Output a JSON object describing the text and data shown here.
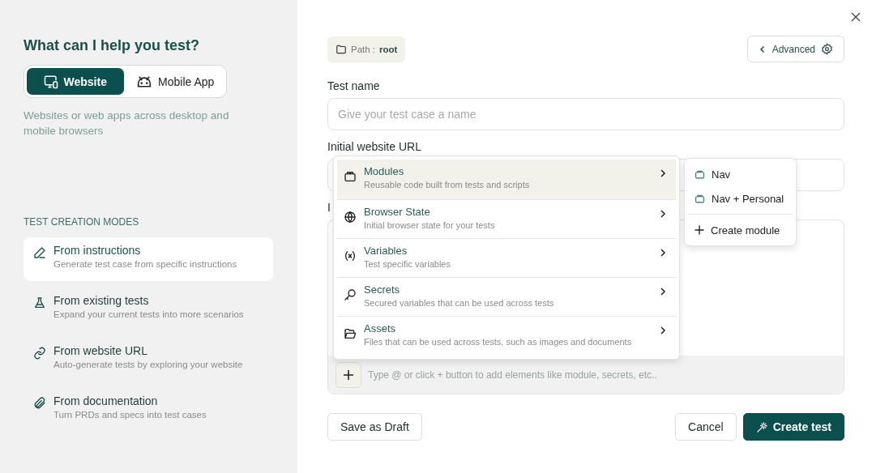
{
  "sidebar": {
    "title": "What can I help you test?",
    "platform_tabs": [
      {
        "label": "Website",
        "selected": true
      },
      {
        "label": "Mobile App",
        "selected": false
      }
    ],
    "description": "Websites or web apps across desktop and mobile browsers",
    "section_label": "TEST CREATION MODES",
    "modes": [
      {
        "title": "From instructions",
        "subtitle": "Generate test case from specific instructions",
        "selected": true
      },
      {
        "title": "From existing tests",
        "subtitle": "Expand your current tests into more scenarios",
        "selected": false
      },
      {
        "title": "From website URL",
        "subtitle": "Auto-generate tests by exploring your website",
        "selected": false
      },
      {
        "title": "From documentation",
        "subtitle": "Turn PRDs and specs into test cases",
        "selected": false
      }
    ]
  },
  "form": {
    "path_label": "Path :",
    "path_value": "root",
    "advanced_button": "Advanced",
    "test_name": {
      "label": "Test name",
      "placeholder": "Give your test case a name"
    },
    "url": {
      "label": "Initial website URL"
    },
    "instructions": {
      "label": "I",
      "hint": "Type @ or click + button to add elements like module, secrets, etc.."
    },
    "buttons": {
      "draft": "Save as Draft",
      "cancel": "Cancel",
      "create": "Create test"
    }
  },
  "insert_menu": {
    "items": [
      {
        "title": "Modules",
        "subtitle": "Reusable code built from tests and scripts",
        "selected": true
      },
      {
        "title": "Browser State",
        "subtitle": "Initial browser state for your tests",
        "selected": false
      },
      {
        "title": "Variables",
        "subtitle": "Test specific variables",
        "selected": false
      },
      {
        "title": "Secrets",
        "subtitle": "Secured variables that can be used across tests",
        "selected": false
      },
      {
        "title": "Assets",
        "subtitle": "Files that can be used across tests, such as images and documents",
        "selected": false
      }
    ]
  },
  "modules_submenu": {
    "items": [
      {
        "label": "Nav"
      },
      {
        "label": "Nav + Personal"
      }
    ],
    "create": "Create module"
  }
}
